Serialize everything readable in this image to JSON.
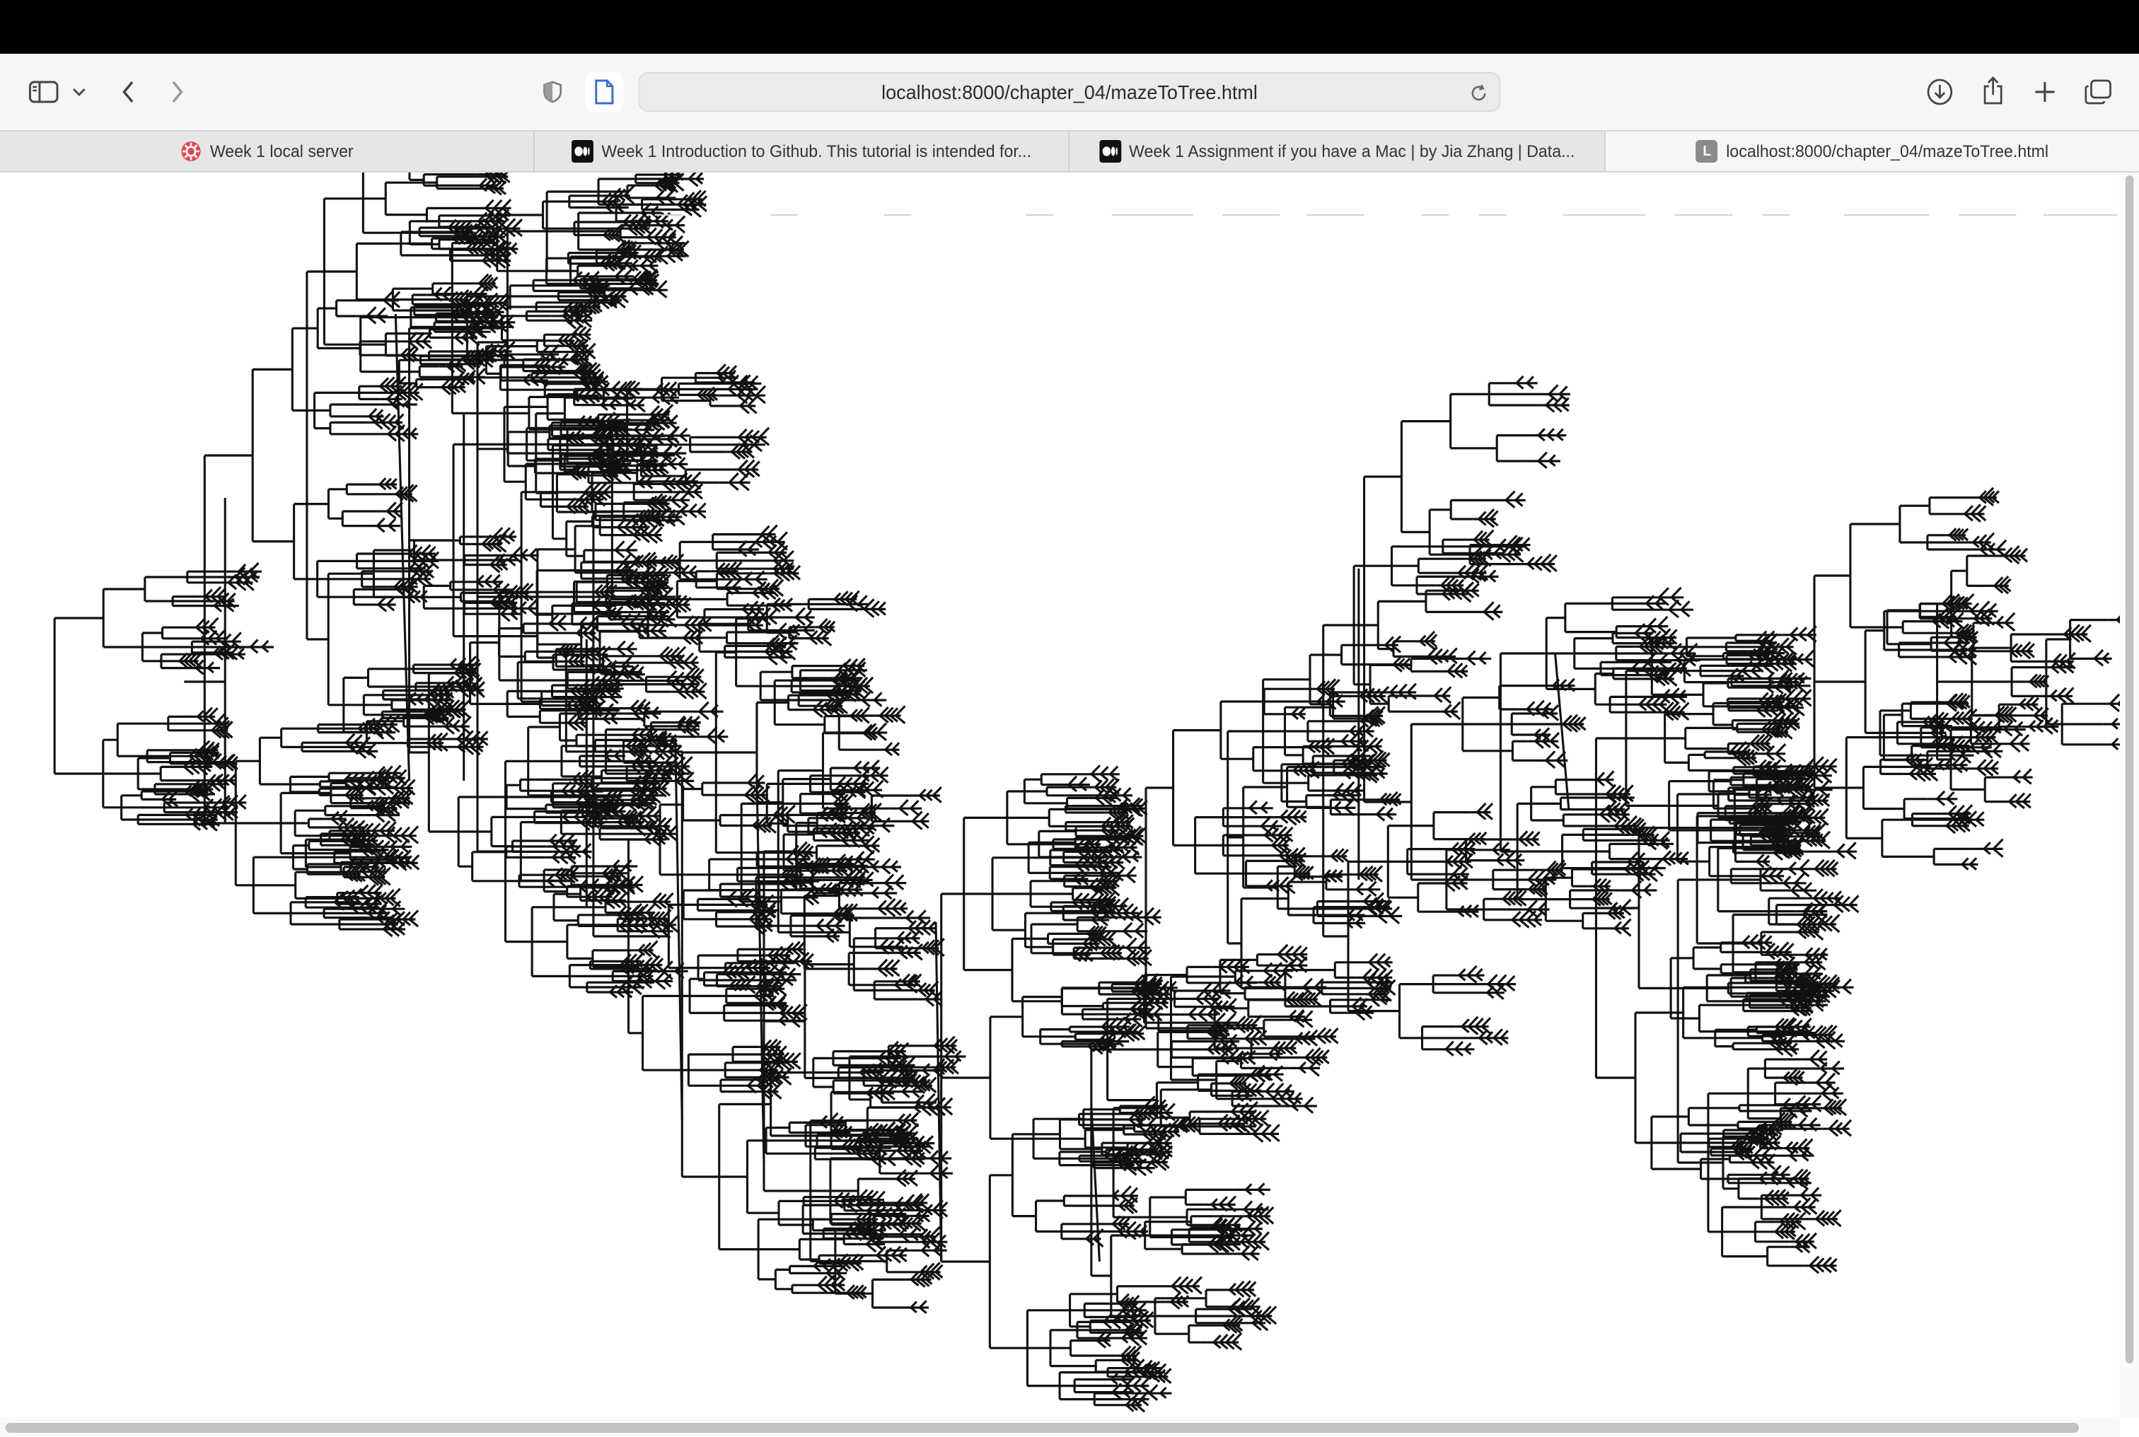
{
  "browser": {
    "toolbar": {
      "sidebar_icon": "sidebar-icon",
      "back_icon": "chevron-left-icon",
      "forward_icon": "chevron-right-icon",
      "privacy_icon": "shield-icon",
      "page_icon": "page-icon",
      "download_icon": "download-icon",
      "share_icon": "share-icon",
      "new_tab_icon": "plus-icon",
      "tab_overview_icon": "tabs-overview-icon"
    },
    "address_bar": {
      "url": "localhost:8000/chapter_04/mazeToTree.html",
      "reload_icon": "reload-icon"
    },
    "tabs": [
      {
        "label": "Week 1 local server",
        "favicon": "gear-icon",
        "active": false
      },
      {
        "label": "Week 1 Introduction to Github. This tutorial is intended for...",
        "favicon": "medium-icon",
        "active": false
      },
      {
        "label": "Week 1 Assignment if you have a Mac | by Jia Zhang | Data...",
        "favicon": "medium-icon",
        "active": false
      },
      {
        "label": "localhost:8000/chapter_04/mazeToTree.html",
        "favicon": "L",
        "active": true
      }
    ]
  },
  "page": {
    "visualization": "maze-tree",
    "stroke_color": "#111111",
    "background_color": "#ffffff"
  },
  "colors": {
    "accent_favicon": "#e0474c",
    "toolbar_bg": "#f6f6f6",
    "tabbar_bg": "#e6e6e6"
  }
}
